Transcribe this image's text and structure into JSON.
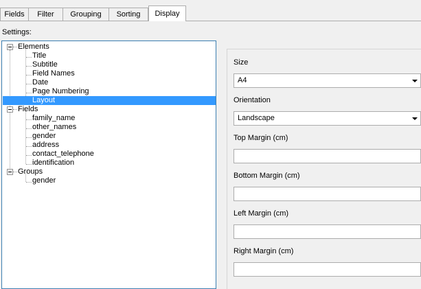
{
  "tabs": [
    {
      "label": "Fields"
    },
    {
      "label": "Filter"
    },
    {
      "label": "Grouping"
    },
    {
      "label": "Sorting"
    },
    {
      "label": "Display"
    }
  ],
  "settings_label": "Settings:",
  "tree": {
    "groups": [
      {
        "label": "Elements",
        "children": [
          "Title",
          "Subtitle",
          "Field Names",
          "Date",
          "Page Numbering",
          "Layout"
        ]
      },
      {
        "label": "Fields",
        "children": [
          "family_name",
          "other_names",
          "gender",
          "address",
          "contact_telephone",
          "identification"
        ]
      },
      {
        "label": "Groups",
        "children": [
          "gender"
        ]
      }
    ],
    "selected": "Layout"
  },
  "panel": {
    "size_label": "Size",
    "size_value": "A4",
    "orientation_label": "Orientation",
    "orientation_value": "Landscape",
    "top_margin_label": "Top Margin (cm)",
    "top_margin_value": "",
    "bottom_margin_label": "Bottom Margin (cm)",
    "bottom_margin_value": "",
    "left_margin_label": "Left Margin (cm)",
    "left_margin_value": "",
    "right_margin_label": "Right Margin (cm)",
    "right_margin_value": ""
  },
  "colors": {
    "selection": "#3399ff",
    "tree_border": "#3c7fb1"
  }
}
